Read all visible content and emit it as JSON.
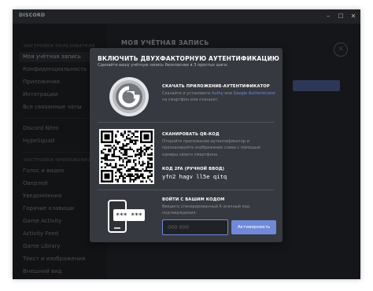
{
  "window": {
    "title": "DISCORD",
    "controls": {
      "minimize": "–",
      "maximize": "☐",
      "close": "✕"
    }
  },
  "sidebar": {
    "section1_header": "НАСТРОЙКИ ПОЛЬЗОВАТЕЛЯ",
    "section1": [
      "Моя учётная запись",
      "Конфиденциальность",
      "Приложения",
      "Интеграции",
      "Все связанные чаты"
    ],
    "section2": [
      "Discord Nitro",
      "HypeSquad"
    ],
    "section3_header": "НАСТРОЙКИ ПРИЛОЖЕНИЯ",
    "section3": [
      "Голос и видео",
      "Оверлей",
      "Уведомления",
      "Горячие клавиши",
      "Game Activity",
      "Activity Feed",
      "Game Library",
      "Текст и изображения",
      "Внешний вид"
    ],
    "active_item": "Моя учётная запись"
  },
  "content": {
    "title": "МОЯ УЧЁТНАЯ ЗАПИСЬ"
  },
  "modal": {
    "title": "ВКЛЮЧИТЬ ДВУХФАКТОРНУЮ АУТЕНТИФИКАЦИЮ",
    "subtitle": "Сделайте вашу учётную запись безопаснее в 3 простых шага:",
    "close_icon": "×",
    "step1": {
      "title": "СКАЧАТЬ ПРИЛОЖЕНИЕ-АУТЕНТИФИКАТОР",
      "text_before": "Скачайте и установите ",
      "link1": "Authy",
      "text_middle": " или ",
      "link2": "Google Authenticator",
      "text_after": " на смартфон или планшет."
    },
    "step2": {
      "title": "СКАНИРОВАТЬ QR-КОД",
      "text": "Откройте приложение-аутентификатор и просканируйте изображение слева с помощью камеры своего смартфона.",
      "key_label": "КОД 2FA (РУЧНОЙ ВВОД)",
      "key_value": "yfn2 hagv ll5e qitq"
    },
    "step3": {
      "title": "ВОЙТИ С ВАШИМ КОДОМ",
      "text": "Введите сгенерированный 6-значный код подтверждения.",
      "input_placeholder": "000 000",
      "button_label": "Активировать",
      "phone_code": "*** ***"
    }
  },
  "colors": {
    "titlebar": "#202225",
    "sidebar": "#2f3136",
    "content": "#36393f",
    "accent": "#7289da",
    "muted_text": "#8e9297"
  }
}
